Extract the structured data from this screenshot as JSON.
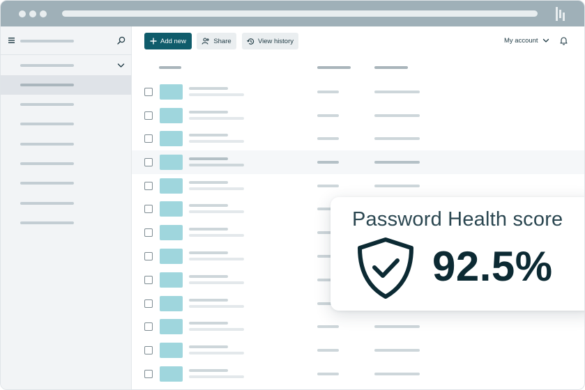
{
  "toolbar": {
    "add_new_label": "Add new",
    "share_label": "Share",
    "view_history_label": "View history"
  },
  "account": {
    "label": "My account"
  },
  "score_card": {
    "title": "Password Health score",
    "value": "92.5%"
  },
  "icons": {
    "menu": "hamburger-icon",
    "search": "search-icon",
    "sidebar_expand": "chevron-down-icon",
    "add": "plus-icon",
    "share": "share-user-icon",
    "history": "history-icon",
    "account_dropdown": "chevron-down-icon",
    "notifications": "bell-icon",
    "security": "shield-check-icon",
    "brand": "brand-logo"
  },
  "colors": {
    "primary": "#0f5c6b",
    "title_bar": "#9fb0b8",
    "thumbnail": "#9fd6dd",
    "sidebar_bg": "#f2f4f6",
    "score_text": "#0c2a33"
  }
}
